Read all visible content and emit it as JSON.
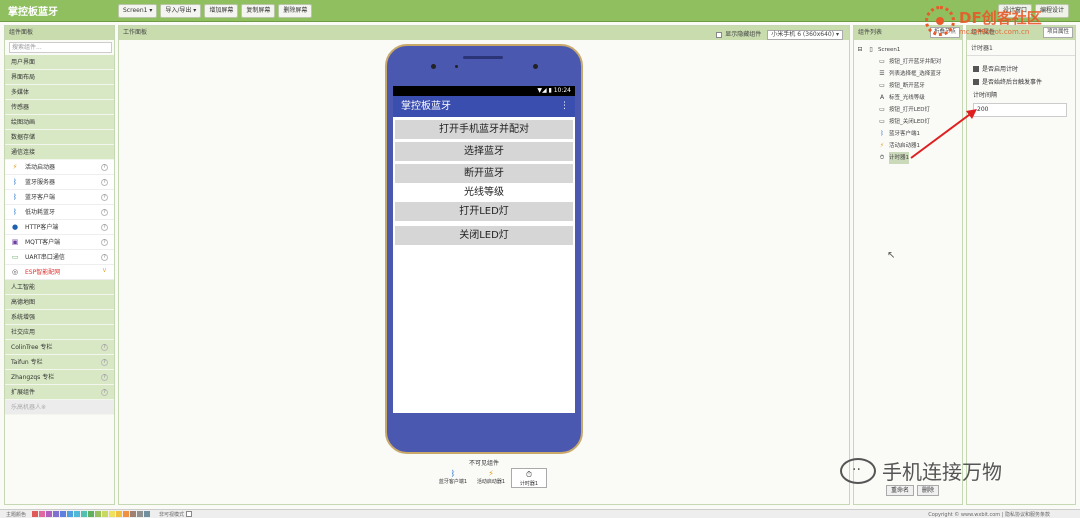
{
  "app": {
    "title": "掌控板蓝牙",
    "top_buttons": [
      "Screen1 ▾",
      "导入/导出 ▾",
      "增加屏幕",
      "复制屏幕",
      "删除屏幕"
    ],
    "top_right_buttons": [
      "设计窗口",
      "编程设计"
    ]
  },
  "watermark": {
    "main": "DF创客社区",
    "sub": "mc.DFRobot.com.cn"
  },
  "palette": {
    "title": "组件面板",
    "search_placeholder": "搜索组件...",
    "categories_top": [
      "用户界面",
      "界面布局",
      "多媒体",
      "传感器",
      "绘图动画",
      "数据存储",
      "通信连接"
    ],
    "items": [
      {
        "label": "活动启动器",
        "icon": "⚡",
        "help": "?"
      },
      {
        "label": "蓝牙服务器",
        "icon": "ᛒ",
        "help": "?"
      },
      {
        "label": "蓝牙客户端",
        "icon": "ᛒ",
        "help": "?"
      },
      {
        "label": "低功耗蓝牙",
        "icon": "ᛒ",
        "help": "?"
      },
      {
        "label": "HTTP客户端",
        "icon": "●",
        "help": "?"
      },
      {
        "label": "MQTT客户端",
        "icon": "▣",
        "help": "?"
      },
      {
        "label": "UART串口通信",
        "icon": "▭",
        "help": "?"
      },
      {
        "label": "ESP智能配网",
        "icon": "◎",
        "help": "V"
      }
    ],
    "categories_bottom": [
      "人工智能",
      "高德地图",
      "系统增强",
      "社交应用",
      "ColinTree 专栏",
      "Taifun 专栏",
      "Zhangzqs 专栏",
      "扩展组件"
    ],
    "categories_bottom_help": [
      "",
      "",
      "",
      "",
      "?",
      "?",
      "?",
      "?"
    ],
    "disabled_category": "乐高机器人※"
  },
  "viewer": {
    "title": "工作面板",
    "hide_label": "显示隐藏组件",
    "device": "小米手机 6 (360x640) ▾",
    "status_time": "▼◢ ▮ 10:24",
    "app_title": "掌控板蓝牙",
    "menu_dots": "⋮",
    "buttons": [
      {
        "type": "button",
        "text": "打开手机蓝牙并配对"
      },
      {
        "type": "button",
        "text": "选择蓝牙"
      },
      {
        "type": "button",
        "text": "断开蓝牙"
      },
      {
        "type": "label",
        "text": "光线等级"
      },
      {
        "type": "button",
        "text": "打开LED灯"
      },
      {
        "type": "button",
        "text": "关闭LED灯"
      }
    ],
    "nonvisible_title": "不可见组件",
    "nonvisible": [
      {
        "label": "蓝牙客户端1",
        "icon": "ᛒ",
        "selected": false
      },
      {
        "label": "活动启动器1",
        "icon": "⚡",
        "selected": false
      },
      {
        "label": "计时器1",
        "icon": "⏱",
        "selected": true
      }
    ]
  },
  "components": {
    "title": "组件列表",
    "collapse_btn": "折叠节点",
    "root": "Screen1",
    "root_toggle": "⊟",
    "children": [
      {
        "label": "按钮_打开蓝牙并配对",
        "icon": "▭"
      },
      {
        "label": "列表选择框_选择蓝牙",
        "icon": "☰"
      },
      {
        "label": "按钮_断开蓝牙",
        "icon": "▭"
      },
      {
        "label": "标签_光线等级",
        "icon": "A"
      },
      {
        "label": "按钮_打开LED灯",
        "icon": "▭"
      },
      {
        "label": "按钮_关闭LED灯",
        "icon": "▭"
      },
      {
        "label": "蓝牙客户端1",
        "icon": "ᛒ"
      },
      {
        "label": "活动启动器1",
        "icon": "⚡"
      },
      {
        "label": "计时器1",
        "icon": "⏱"
      }
    ],
    "selected_index": 8,
    "rename_btn": "重命名",
    "delete_btn": "删除"
  },
  "properties": {
    "title": "组件属性",
    "head_btn": "项目属性",
    "component_name": "计时器1",
    "checkbox1": "是否启用计时",
    "checkbox2": "是否始终后台触发事件",
    "interval_label": "计时间隔",
    "interval_value": "200"
  },
  "bottom": {
    "left_label": "主题颜色",
    "swatch_colors": [
      "#e05a5a",
      "#e06aa0",
      "#b060c0",
      "#8070d0",
      "#6080e0",
      "#50a0e0",
      "#50b8d8",
      "#50c0b0",
      "#60b060",
      "#9ac060",
      "#c8d860",
      "#f0e060",
      "#f0c040",
      "#f09040",
      "#a08070",
      "#909090",
      "#7090a0"
    ],
    "mode_label": "非可视模式",
    "copyright": "Copyright © www.wxbit.com | 隐私协议和服务条款"
  },
  "social": {
    "text": "手机连接万物"
  },
  "colors": {
    "accent": "#8fbf5e",
    "category": "#d8e8c4",
    "phone": "#4a58b0",
    "appbar": "#3a4eb0",
    "arrow": "#e02020"
  }
}
